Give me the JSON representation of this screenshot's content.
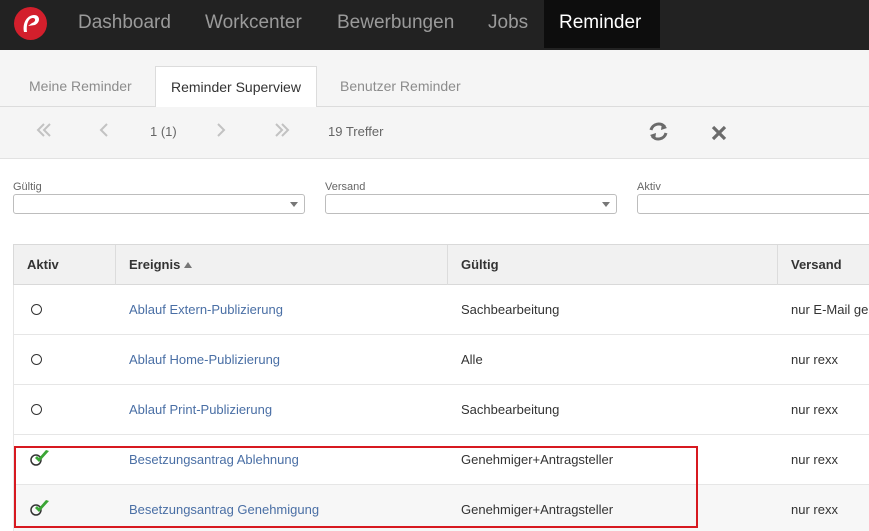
{
  "nav": {
    "items": [
      {
        "label": "Dashboard",
        "active": false
      },
      {
        "label": "Workcenter",
        "active": false
      },
      {
        "label": "Bewerbungen",
        "active": false
      },
      {
        "label": "Jobs",
        "active": false
      },
      {
        "label": "Reminder",
        "active": true
      }
    ]
  },
  "tabs": [
    {
      "label": "Meine Reminder",
      "active": false
    },
    {
      "label": "Reminder Superview",
      "active": true
    },
    {
      "label": "Benutzer Reminder",
      "active": false
    }
  ],
  "pager": {
    "page": "1 (1)",
    "hits": "19 Treffer",
    "icons": [
      "first-page-icon",
      "prev-page-icon",
      "next-page-icon",
      "last-page-icon",
      "refresh-icon",
      "close-icon"
    ]
  },
  "filters": [
    {
      "label": "Gültig",
      "value": ""
    },
    {
      "label": "Versand",
      "value": ""
    },
    {
      "label": "Aktiv",
      "value": ""
    }
  ],
  "table": {
    "columns": [
      "Aktiv",
      "Ereignis",
      "Gültig",
      "Versand"
    ],
    "sorted_column": "Ereignis",
    "sort_direction": "ascending",
    "rows": [
      {
        "aktiv": false,
        "ereignis": "Ablauf Extern-Publizierung",
        "gueltig": "Sachbearbeitung",
        "versand": "nur E-Mail ge"
      },
      {
        "aktiv": false,
        "ereignis": "Ablauf Home-Publizierung",
        "gueltig": "Alle",
        "versand": "nur rexx"
      },
      {
        "aktiv": false,
        "ereignis": "Ablauf Print-Publizierung",
        "gueltig": "Sachbearbeitung",
        "versand": "nur rexx"
      },
      {
        "aktiv": true,
        "ereignis": "Besetzungsantrag Ablehnung",
        "gueltig": "Genehmiger+Antragsteller",
        "versand": "nur rexx"
      },
      {
        "aktiv": true,
        "ereignis": "Besetzungsantrag Genehmigung",
        "gueltig": "Genehmiger+Antragsteller",
        "versand": "nur rexx"
      }
    ]
  },
  "colors": {
    "topbar": "#222222",
    "brand": "#d31f2c",
    "link": "#4a6fa5",
    "check": "#3aa635",
    "highlight": "#d71920"
  }
}
